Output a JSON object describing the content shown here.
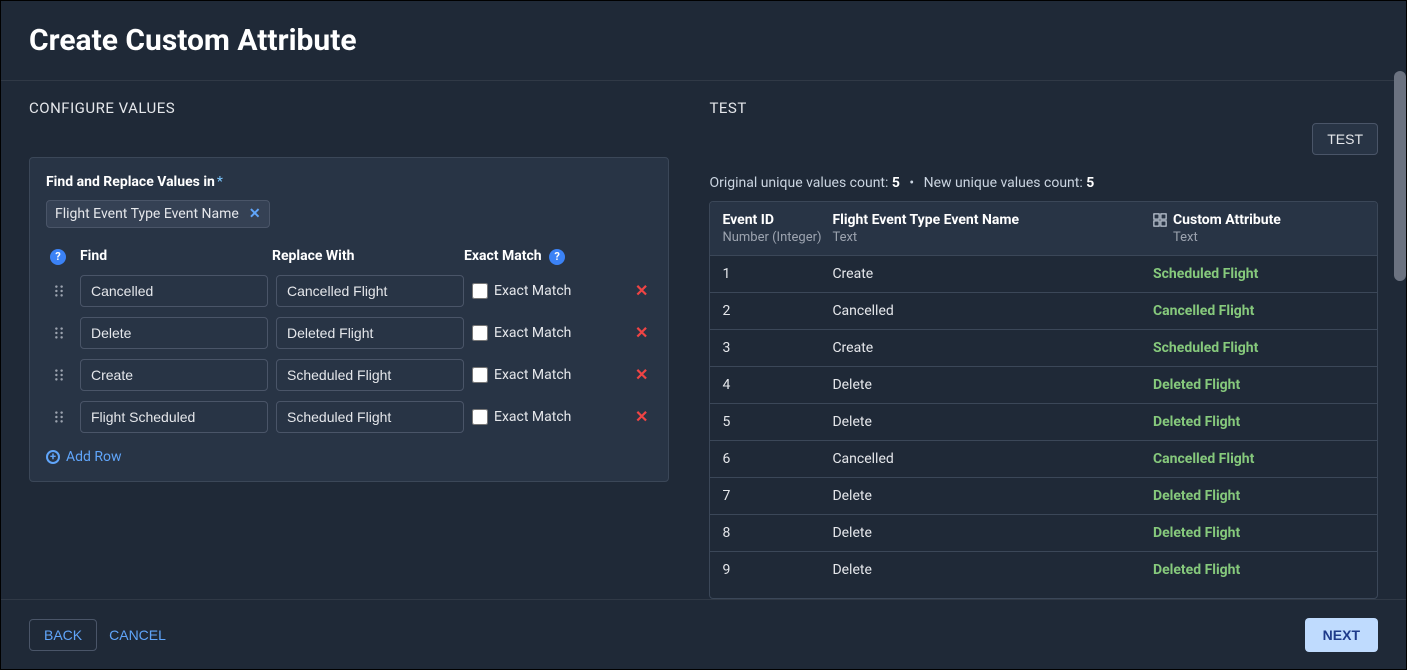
{
  "header": {
    "title": "Create Custom Attribute"
  },
  "left": {
    "section_title": "CONFIGURE VALUES",
    "card_label": "Find and Replace Values in",
    "chip": "Flight Event Type Event Name",
    "columns": {
      "find": "Find",
      "replace": "Replace With",
      "match": "Exact Match"
    },
    "match_cell_label": "Exact Match",
    "rules": [
      {
        "find": "Cancelled",
        "replace": "Cancelled Flight",
        "exact": false
      },
      {
        "find": "Delete",
        "replace": "Deleted Flight",
        "exact": false
      },
      {
        "find": "Create",
        "replace": "Scheduled Flight",
        "exact": false
      },
      {
        "find": "Flight Scheduled",
        "replace": "Scheduled Flight",
        "exact": false
      }
    ],
    "add_row": "Add Row"
  },
  "right": {
    "section_title": "TEST",
    "test_button": "TEST",
    "counts": {
      "orig_label": "Original unique values count:",
      "orig_value": "5",
      "new_label": "New unique values count:",
      "new_value": "5"
    },
    "table": {
      "headers": {
        "id": "Event ID",
        "id_type": "Number (Integer)",
        "name": "Flight Event Type Event Name",
        "name_type": "Text",
        "attr": "Custom Attribute",
        "attr_type": "Text"
      },
      "rows": [
        {
          "id": "1",
          "name": "Create",
          "attr": "Scheduled Flight"
        },
        {
          "id": "2",
          "name": "Cancelled",
          "attr": "Cancelled Flight"
        },
        {
          "id": "3",
          "name": "Create",
          "attr": "Scheduled Flight"
        },
        {
          "id": "4",
          "name": "Delete",
          "attr": "Deleted Flight"
        },
        {
          "id": "5",
          "name": "Delete",
          "attr": "Deleted Flight"
        },
        {
          "id": "6",
          "name": "Cancelled",
          "attr": "Cancelled Flight"
        },
        {
          "id": "7",
          "name": "Delete",
          "attr": "Deleted Flight"
        },
        {
          "id": "8",
          "name": "Delete",
          "attr": "Deleted Flight"
        },
        {
          "id": "9",
          "name": "Delete",
          "attr": "Deleted Flight"
        }
      ]
    }
  },
  "footer": {
    "back": "BACK",
    "cancel": "CANCEL",
    "next": "NEXT"
  }
}
